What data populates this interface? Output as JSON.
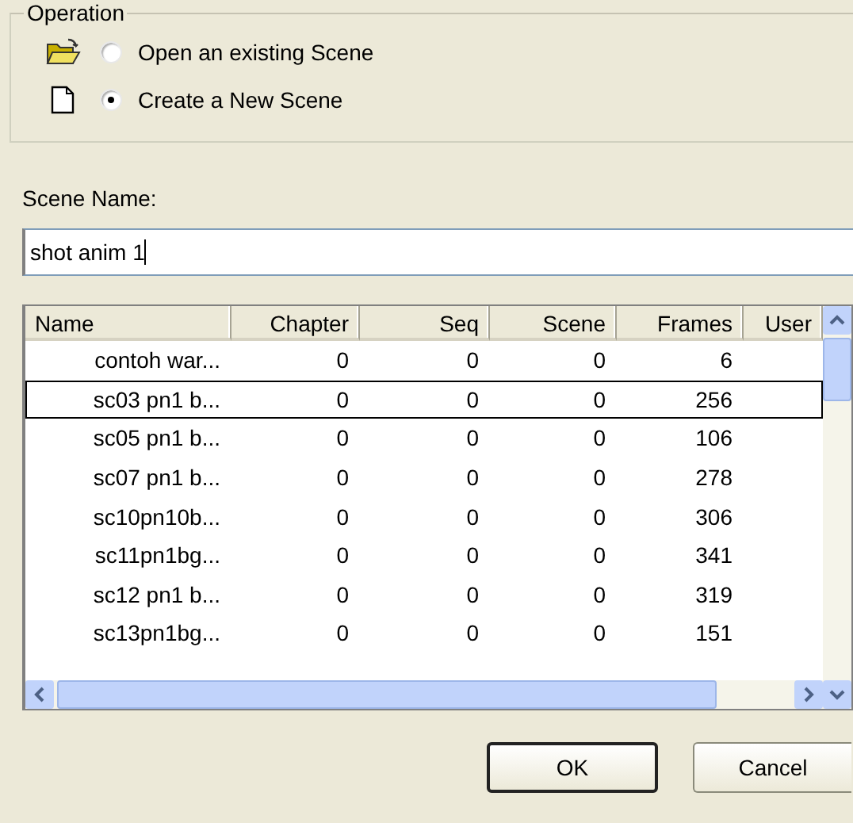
{
  "operation": {
    "title": "Operation",
    "options": [
      {
        "label": "Open an existing Scene",
        "kind": "open",
        "selected": false
      },
      {
        "label": "Create a New Scene",
        "kind": "new",
        "selected": true
      }
    ]
  },
  "scene_name": {
    "label": "Scene Name:",
    "value": "shot anim 1"
  },
  "table": {
    "columns": [
      "Name",
      "Chapter",
      "Seq",
      "Scene",
      "Frames",
      "User"
    ],
    "rows": [
      {
        "cells": [
          "contoh war...",
          "0",
          "0",
          "0",
          "6",
          ""
        ],
        "selected": false
      },
      {
        "cells": [
          "sc03 pn1 b...",
          "0",
          "0",
          "0",
          "256",
          ""
        ],
        "selected": true
      },
      {
        "cells": [
          "sc05 pn1 b...",
          "0",
          "0",
          "0",
          "106",
          ""
        ],
        "selected": false
      },
      {
        "cells": [
          "sc07 pn1 b...",
          "0",
          "0",
          "0",
          "278",
          ""
        ],
        "selected": false
      },
      {
        "cells": [
          "sc10pn10b...",
          "0",
          "0",
          "0",
          "306",
          ""
        ],
        "selected": false
      },
      {
        "cells": [
          "sc11pn1bg...",
          "0",
          "0",
          "0",
          "341",
          ""
        ],
        "selected": false
      },
      {
        "cells": [
          "sc12 pn1 b...",
          "0",
          "0",
          "0",
          "319",
          ""
        ],
        "selected": false
      },
      {
        "cells": [
          "sc13pn1bg...",
          "0",
          "0",
          "0",
          "151",
          ""
        ],
        "selected": false
      }
    ]
  },
  "buttons": [
    {
      "label": "OK",
      "kind": "default"
    },
    {
      "label": "Cancel",
      "kind": "normal"
    }
  ]
}
